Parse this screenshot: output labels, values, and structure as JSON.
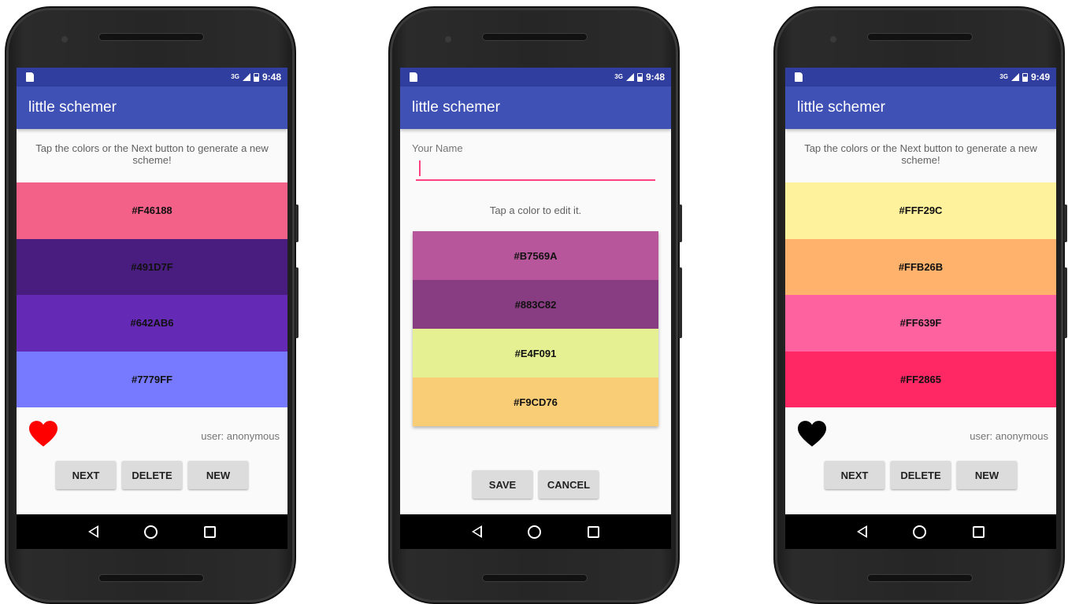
{
  "colors": {
    "status_bar": "#303f9f",
    "app_bar": "#3f51b5",
    "accent": "#ff4081",
    "heart_liked": "#ff0000",
    "heart_unliked": "#000000"
  },
  "phone1": {
    "status": {
      "signal": "3G",
      "time": "9:48"
    },
    "title": "little schemer",
    "instruction": "Tap the colors or the Next button to generate a new scheme!",
    "swatches": [
      {
        "label": "#F46188",
        "color": "#F46188"
      },
      {
        "label": "#491D7F",
        "color": "#491D7F"
      },
      {
        "label": "#642AB6",
        "color": "#642AB6"
      },
      {
        "label": "#7779FF",
        "color": "#7779FF"
      }
    ],
    "heart_icon": "heart-icon-filled-red",
    "user": "user: anonymous",
    "buttons": {
      "next": "NEXT",
      "delete": "DELETE",
      "new": "NEW"
    }
  },
  "phone2": {
    "status": {
      "signal": "3G",
      "time": "9:48"
    },
    "title": "little schemer",
    "name_label": "Your Name",
    "name_value": "",
    "hint": "Tap a color to edit it.",
    "swatches": [
      {
        "label": "#B7569A",
        "color": "#B7569A"
      },
      {
        "label": "#883C82",
        "color": "#883C82"
      },
      {
        "label": "#E4F091",
        "color": "#E4F091"
      },
      {
        "label": "#F9CD76",
        "color": "#F9CD76"
      }
    ],
    "buttons": {
      "save": "SAVE",
      "cancel": "CANCEL"
    }
  },
  "phone3": {
    "status": {
      "signal": "3G",
      "time": "9:49"
    },
    "title": "little schemer",
    "instruction": "Tap the colors or the Next button to generate a new scheme!",
    "swatches": [
      {
        "label": "#FFF29C",
        "color": "#FFF29C"
      },
      {
        "label": "#FFB26B",
        "color": "#FFB26B"
      },
      {
        "label": "#FF639F",
        "color": "#FF639F"
      },
      {
        "label": "#FF2865",
        "color": "#FF2865"
      }
    ],
    "heart_icon": "heart-icon-filled-black",
    "user": "user: anonymous",
    "buttons": {
      "next": "NEXT",
      "delete": "DELETE",
      "new": "NEW"
    }
  }
}
